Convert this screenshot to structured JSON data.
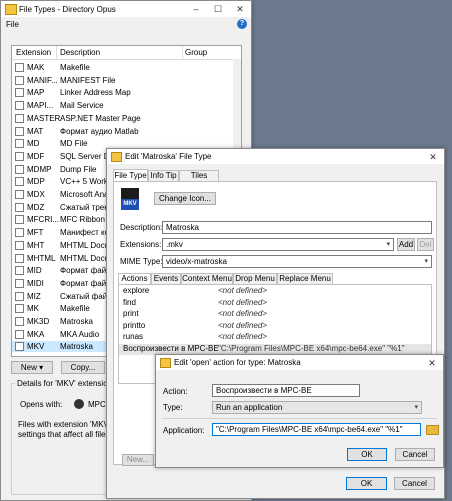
{
  "file_types_window": {
    "title": "File Types - Directory Opus",
    "menu_file": "File",
    "help_icon_text": "?",
    "columns": {
      "extension": "Extension",
      "description": "Description",
      "group": "Group"
    },
    "rows": [
      {
        "ext": "MAK",
        "desc": "Makefile"
      },
      {
        "ext": "MANIF...",
        "desc": "MANIFEST File"
      },
      {
        "ext": "MAP",
        "desc": "Linker Address Map"
      },
      {
        "ext": "MAPI...",
        "desc": "Mail Service"
      },
      {
        "ext": "MASTER",
        "desc": "ASP.NET Master Page"
      },
      {
        "ext": "MAT",
        "desc": "Формат аудио Matlab"
      },
      {
        "ext": "MD",
        "desc": "MD File"
      },
      {
        "ext": "MDF",
        "desc": "SQL Server Data"
      },
      {
        "ext": "MDMP",
        "desc": "Dump File"
      },
      {
        "ext": "MDP",
        "desc": "VC++ 5 Worksp"
      },
      {
        "ext": "MDX",
        "desc": "Microsoft Analy"
      },
      {
        "ext": "MDZ",
        "desc": "Сжатый трекер"
      },
      {
        "ext": "MFCRI...",
        "desc": "MFC Ribbon De"
      },
      {
        "ext": "MFT",
        "desc": "Манифест конт"
      },
      {
        "ext": "MHT",
        "desc": "MHTML Docum"
      },
      {
        "ext": "MHTML",
        "desc": "MHTML Docum"
      },
      {
        "ext": "MID",
        "desc": "Формат файла"
      },
      {
        "ext": "MIDI",
        "desc": "Формат файла"
      },
      {
        "ext": "MIZ",
        "desc": "Сжатый файл"
      },
      {
        "ext": "MK",
        "desc": "Makefile"
      },
      {
        "ext": "MK3D",
        "desc": "Matroska"
      },
      {
        "ext": "MKA",
        "desc": "MKA Audio"
      },
      {
        "ext": "MKV",
        "desc": "Matroska"
      }
    ],
    "new_button": "New",
    "copy_button": "Copy...",
    "details_label": "Details for 'MKV' extension",
    "opens_with_label": "Opens with:",
    "opens_with_value": "MPC-HC",
    "files_with_text_1": "Files with extension 'MKV' a",
    "files_with_text_2": "settings that affect all files c"
  },
  "edit_type_dialog": {
    "title": "Edit 'Matroska' File Type",
    "tabs": [
      "File Type",
      "Info Tip",
      "Tiles Mode"
    ],
    "change_icon_button": "Change Icon...",
    "icon_text": "MKV",
    "description_label": "Description:",
    "description_value": "Matroska",
    "extensions_label": "Extensions:",
    "extensions_value": ".mkv",
    "add_button": "Add",
    "del_button": "Del",
    "mime_label": "MIME Type:",
    "mime_value": "video/x-matroska",
    "sub_tabs": [
      "Actions",
      "Events",
      "Context Menu",
      "Drop Menu",
      "Replace Menu"
    ],
    "actions": [
      {
        "name": "explore",
        "value": "<not defined>"
      },
      {
        "name": "find",
        "value": "<not defined>"
      },
      {
        "name": "print",
        "value": "<not defined>"
      },
      {
        "name": "printto",
        "value": "<not defined>"
      },
      {
        "name": "runas",
        "value": "<not defined>"
      },
      {
        "name": "Воспроизвести в MPC-BE",
        "value": "\"C:\\Program Files\\MPC-BE x64\\mpc-be64.exe\" \"%1\""
      }
    ],
    "new_button": "New...",
    "ok_button": "OK",
    "cancel_button": "Cancel"
  },
  "action_dialog": {
    "title": "Edit 'open' action for type: Matroska",
    "action_label": "Action:",
    "action_value": "Воспроизвести в MPC-BE",
    "type_label": "Type:",
    "type_value": "Run an application",
    "application_label": "Application:",
    "application_value": "\"C:\\Program Files\\MPC-BE x64\\mpc-be64.exe\" \"%1\"",
    "ok_button": "OK",
    "cancel_button": "Cancel"
  }
}
